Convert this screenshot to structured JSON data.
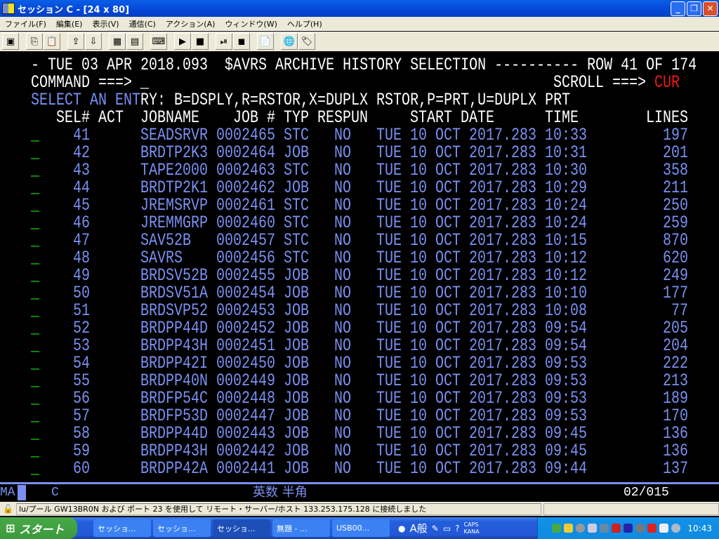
{
  "window": {
    "title": "セッション C - [24 x 80]",
    "minimize": "_",
    "maximize": "❐",
    "close": "✕"
  },
  "menu": [
    "ファイル(F)",
    "編集(E)",
    "表示(V)",
    "通信(C)",
    "アクション(A)",
    "ウィンドウ(W)",
    "ヘルプ(H)"
  ],
  "toolbar": [
    {
      "icon": "display-icon",
      "g": "▣"
    },
    {
      "icon": "copy-icon",
      "g": "⎘",
      "sep": true
    },
    {
      "icon": "paste-icon",
      "g": "📋"
    },
    {
      "icon": "send-file-icon",
      "g": "⇪",
      "sep": true
    },
    {
      "icon": "receive-file-icon",
      "g": "⇩"
    },
    {
      "icon": "color-icon",
      "g": "▦",
      "sep": true
    },
    {
      "icon": "display-setup-icon",
      "g": "▤"
    },
    {
      "icon": "keyboard-icon",
      "g": "⌨",
      "sep": true
    },
    {
      "icon": "macro-play-icon",
      "g": "▶",
      "sep": true
    },
    {
      "icon": "macro-stop-icon",
      "g": "■"
    },
    {
      "icon": "macro-record-icon",
      "g": "⏯",
      "sep": true
    },
    {
      "icon": "macro-pause-icon",
      "g": "◼"
    },
    {
      "icon": "clipboard-icon",
      "g": "📄",
      "sep": true
    },
    {
      "icon": "web-help-icon",
      "g": "🌐",
      "sep": true
    },
    {
      "icon": "tag-icon",
      "g": "🏷"
    }
  ],
  "screen": {
    "title_line": "- TUE 03 APR 2018.093  $AVRS ARCHIVE HISTORY SELECTION ---------- ROW 41 OF 174",
    "command_label": "COMMAND ===>",
    "cursor": "_",
    "scroll_label": "SCROLL ===>",
    "scroll_value": "CUR",
    "select_prompt": "SELECT AN ENT",
    "select_options": "RY: B=DSPLY,R=RSTOR,X=DUPLX RSTOR,P=PRT,U=DUPLX PRT",
    "headers": {
      "sel": "SEL#",
      "act": "ACT",
      "jobname": "JOBNAME",
      "jobnum": "JOB #",
      "typ": "TYP",
      "respun": "RESPUN",
      "start_date": "START DATE",
      "time": "TIME",
      "lines": "LINES"
    },
    "rows": [
      [
        "41",
        "SEADSRVR",
        "0002465",
        "STC",
        "NO",
        "TUE 10 OCT 2017.283",
        "10:33",
        "197"
      ],
      [
        "42",
        "BRDTP2K3",
        "0002464",
        "JOB",
        "NO",
        "TUE 10 OCT 2017.283",
        "10:31",
        "201"
      ],
      [
        "43",
        "TAPE2000",
        "0002463",
        "STC",
        "NO",
        "TUE 10 OCT 2017.283",
        "10:30",
        "358"
      ],
      [
        "44",
        "BRDTP2K1",
        "0002462",
        "JOB",
        "NO",
        "TUE 10 OCT 2017.283",
        "10:29",
        "211"
      ],
      [
        "45",
        "JREMSRVP",
        "0002461",
        "STC",
        "NO",
        "TUE 10 OCT 2017.283",
        "10:24",
        "250"
      ],
      [
        "46",
        "JREMMGRP",
        "0002460",
        "STC",
        "NO",
        "TUE 10 OCT 2017.283",
        "10:24",
        "259"
      ],
      [
        "47",
        "SAV52B",
        "0002457",
        "STC",
        "NO",
        "TUE 10 OCT 2017.283",
        "10:15",
        "870"
      ],
      [
        "48",
        "SAVRS",
        "0002456",
        "STC",
        "NO",
        "TUE 10 OCT 2017.283",
        "10:12",
        "620"
      ],
      [
        "49",
        "BRDSV52B",
        "0002455",
        "JOB",
        "NO",
        "TUE 10 OCT 2017.283",
        "10:12",
        "249"
      ],
      [
        "50",
        "BRDSV51A",
        "0002454",
        "JOB",
        "NO",
        "TUE 10 OCT 2017.283",
        "10:10",
        "177"
      ],
      [
        "51",
        "BRDSVP52",
        "0002453",
        "JOB",
        "NO",
        "TUE 10 OCT 2017.283",
        "10:08",
        "77"
      ],
      [
        "52",
        "BRDPP44D",
        "0002452",
        "JOB",
        "NO",
        "TUE 10 OCT 2017.283",
        "09:54",
        "205"
      ],
      [
        "53",
        "BRDPP43H",
        "0002451",
        "JOB",
        "NO",
        "TUE 10 OCT 2017.283",
        "09:54",
        "204"
      ],
      [
        "54",
        "BRDPP42I",
        "0002450",
        "JOB",
        "NO",
        "TUE 10 OCT 2017.283",
        "09:53",
        "222"
      ],
      [
        "55",
        "BRDPP40N",
        "0002449",
        "JOB",
        "NO",
        "TUE 10 OCT 2017.283",
        "09:53",
        "213"
      ],
      [
        "56",
        "BRDFP54C",
        "0002448",
        "JOB",
        "NO",
        "TUE 10 OCT 2017.283",
        "09:53",
        "189"
      ],
      [
        "57",
        "BRDFP53D",
        "0002447",
        "JOB",
        "NO",
        "TUE 10 OCT 2017.283",
        "09:53",
        "170"
      ],
      [
        "58",
        "BRDPP44D",
        "0002443",
        "JOB",
        "NO",
        "TUE 10 OCT 2017.283",
        "09:45",
        "136"
      ],
      [
        "59",
        "BRDPP43H",
        "0002442",
        "JOB",
        "NO",
        "TUE 10 OCT 2017.283",
        "09:45",
        "136"
      ],
      [
        "60",
        "BRDPP42A",
        "0002441",
        "JOB",
        "NO",
        "TUE 10 OCT 2017.283",
        "09:44",
        "137"
      ]
    ],
    "input_marker": "_"
  },
  "oia": {
    "mode": "MA",
    "session": "C",
    "ime": "英数 半角",
    "cursor_pos": "02/015"
  },
  "statusbar": {
    "message": "lu/プール GW13BR0N および ポート 23 を使用して リモート・サーバー/ホスト 133.253.175.128 に接続しました"
  },
  "taskbar": {
    "start": "スタート",
    "tasks": [
      "セッショ...",
      "セッショ...",
      "セッショ...",
      "無題 - ...",
      "USB00..."
    ],
    "active_task": 2,
    "lang": "A般",
    "caps": "CAPS",
    "kana": "KANA",
    "clock": "10:43"
  },
  "colors": {
    "field_blue": "#7a90f2",
    "input_green": "#10e010",
    "scroll_red": "#f01818",
    "text_white": "#ffffff"
  }
}
